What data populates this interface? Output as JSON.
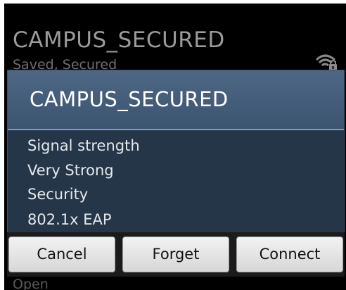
{
  "background": {
    "network": {
      "ssid": "CAMPUS_SECURED",
      "status": "Saved, Secured",
      "signal_icon": "wifi-locked-icon"
    },
    "next_item_label": "Open"
  },
  "dialog": {
    "title": "CAMPUS_SECURED",
    "signal_label": "Signal strength",
    "signal_value": "Very Strong",
    "security_label": "Security",
    "security_value": "802.1x EAP",
    "buttons": {
      "cancel": "Cancel",
      "forget": "Forget",
      "connect": "Connect"
    }
  },
  "colors": {
    "dialog_bg": "#253649",
    "title_bg": "#4e6784",
    "accent_line": "#7fa0c2"
  }
}
